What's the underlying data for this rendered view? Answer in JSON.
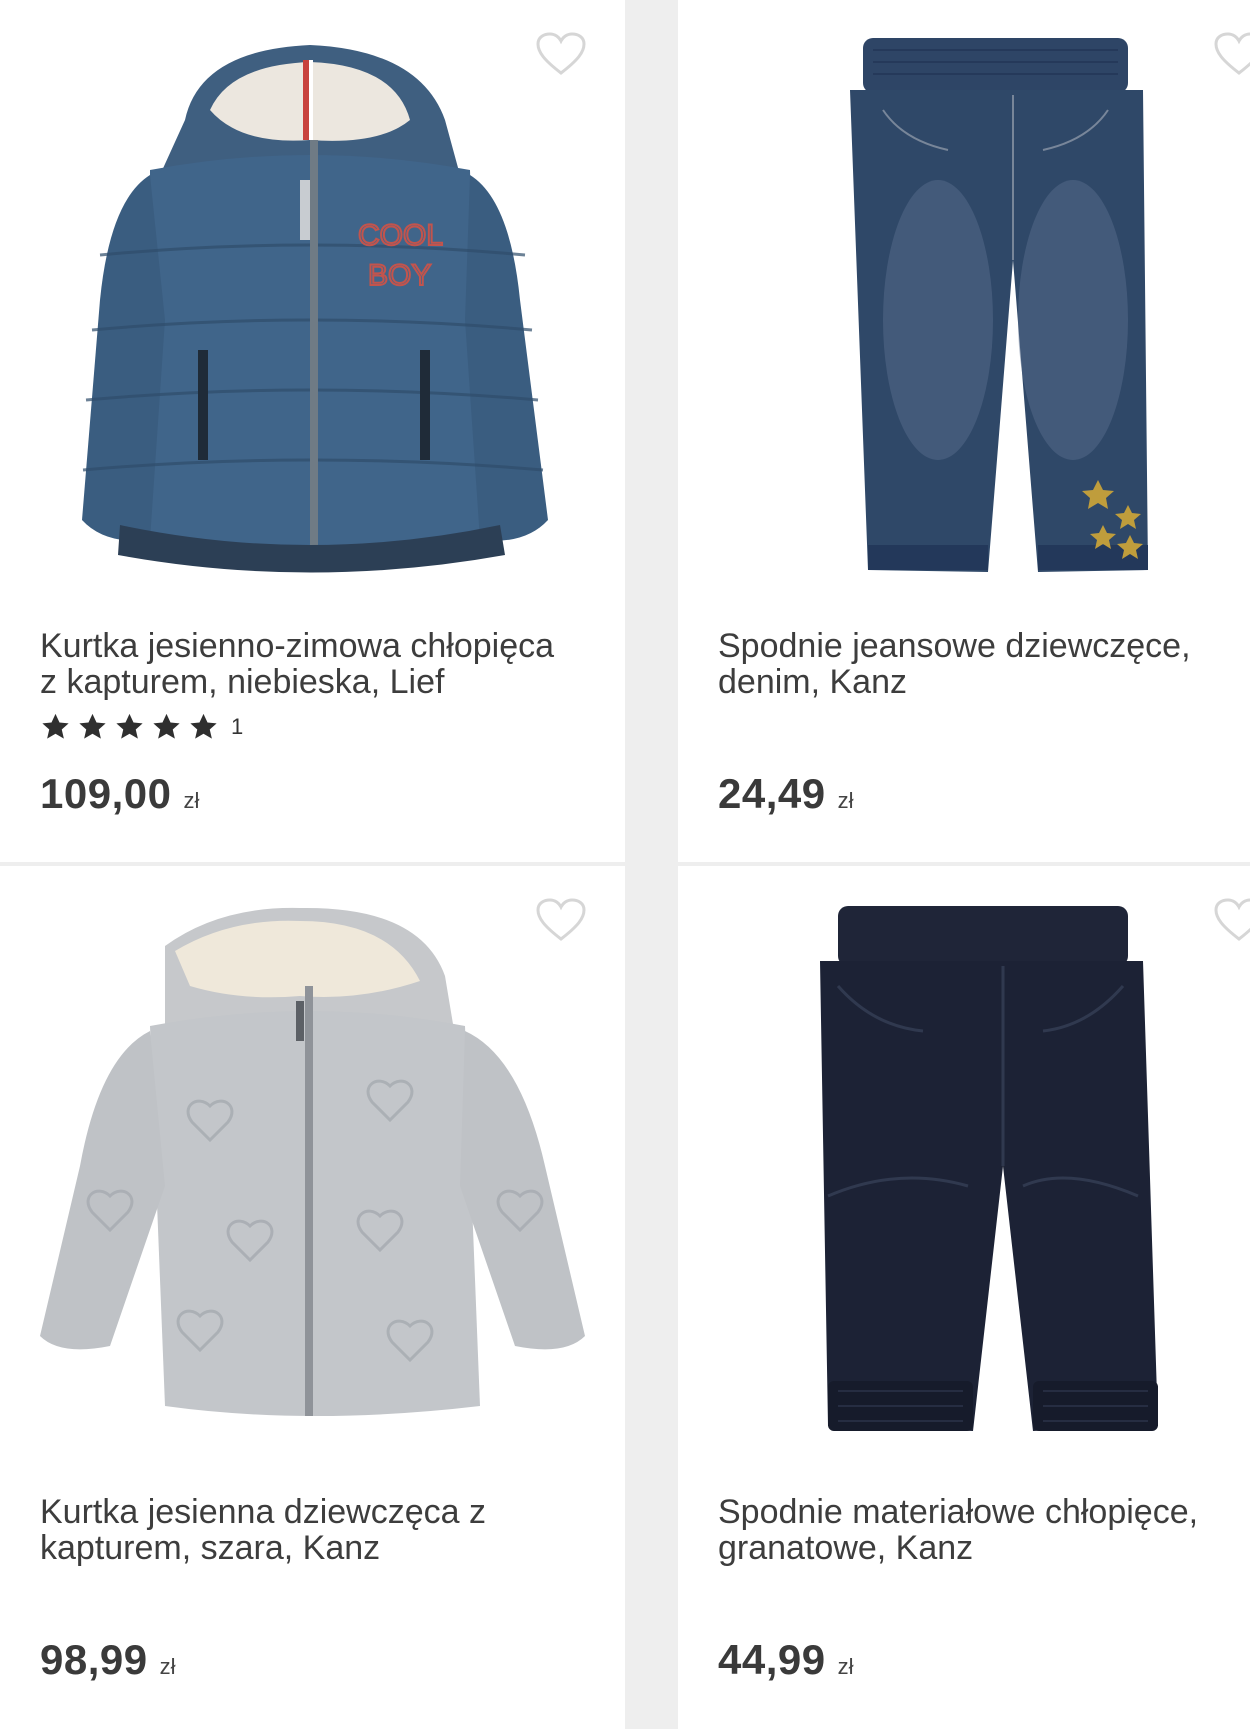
{
  "products": [
    {
      "title": "Kurtka jesienno-zimowa chłopięca z kapturem, niebieska, Lief",
      "rating_count": "1",
      "rating": 5,
      "price": "109,00",
      "currency": "zł",
      "image_print": {
        "line1": "COOL",
        "line2": "BOY"
      }
    },
    {
      "title": "Spodnie jeansowe dziewczęce, denim, Kanz",
      "price": "24,49",
      "currency": "zł"
    },
    {
      "title": "Kurtka jesienna dziewczęca z kapturem, szara, Kanz",
      "price": "98,99",
      "currency": "zł"
    },
    {
      "title": "Spodnie materiałowe chłopięce, granatowe, Kanz",
      "price": "44,99",
      "currency": "zł"
    }
  ],
  "colors": {
    "background": "#eeeeee",
    "card": "#ffffff",
    "text": "#3d3d3d",
    "heart_outline": "#d6d6d6",
    "star": "#2f2f2f"
  }
}
